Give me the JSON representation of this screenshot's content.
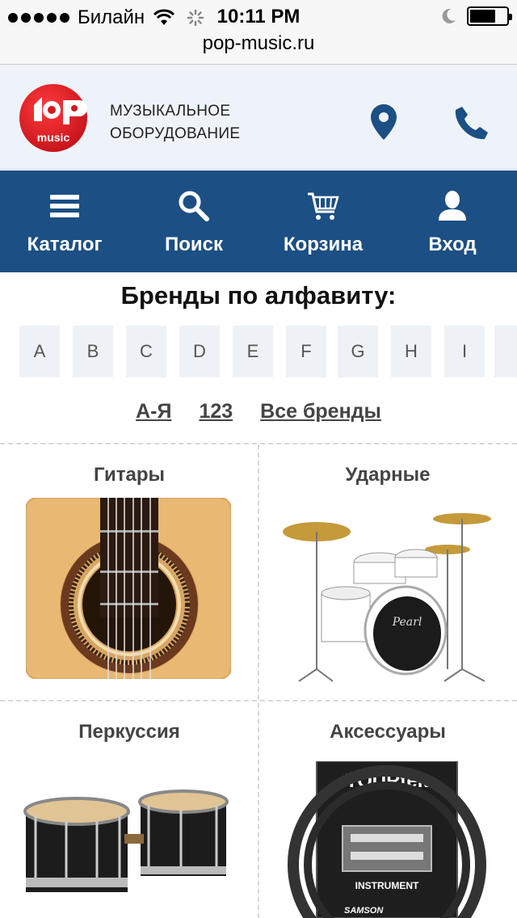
{
  "status_bar": {
    "carrier": "Билайн",
    "time": "10:11 PM"
  },
  "browser": {
    "url": "pop-music.ru"
  },
  "header": {
    "logo_text": "POP music",
    "tagline_line1": "МУЗЫКАЛЬНОЕ",
    "tagline_line2": "ОБОРУДОВАНИЕ",
    "location_icon": "map-pin-icon",
    "phone_icon": "phone-icon"
  },
  "nav": {
    "items": [
      {
        "label": "Каталог",
        "icon": "menu-icon"
      },
      {
        "label": "Поиск",
        "icon": "search-icon"
      },
      {
        "label": "Корзина",
        "icon": "cart-icon"
      },
      {
        "label": "Вход",
        "icon": "user-icon"
      }
    ]
  },
  "brands": {
    "title": "Бренды по алфавиту:",
    "letters": [
      "A",
      "B",
      "C",
      "D",
      "E",
      "F",
      "G",
      "H",
      "I"
    ],
    "links": [
      "А-Я",
      "123",
      "Все бренды"
    ]
  },
  "categories": [
    {
      "title": "Гитары"
    },
    {
      "title": "Ударные"
    },
    {
      "title": "Перкуссия"
    },
    {
      "title": "Аксессуары"
    }
  ],
  "colors": {
    "nav_bg": "#1c4f84",
    "header_bg": "#eef3f9",
    "accent_icon": "#1c4f84",
    "logo_red": "#e11d23"
  }
}
